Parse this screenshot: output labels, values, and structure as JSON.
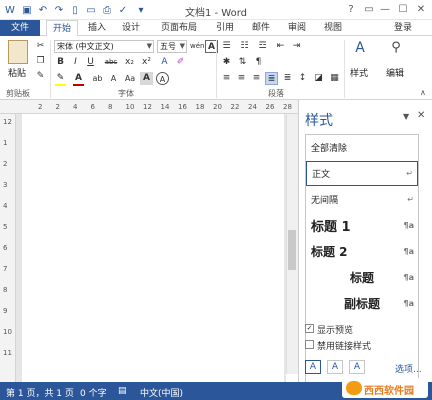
{
  "window": {
    "title": "文档1 - Word",
    "help": "?"
  },
  "tabs": [
    "文件",
    "开始",
    "插入",
    "设计",
    "页面布局",
    "引用",
    "邮件",
    "审阅",
    "视图"
  ],
  "user": "登录",
  "ribbon": {
    "paste_label": "粘贴",
    "font_name": "宋体 (中文正文)",
    "font_size": "五号",
    "groups": [
      "剪贴板",
      "字体",
      "段落",
      "样式",
      "编辑"
    ],
    "styles_label": "样式",
    "edit_label": "编辑",
    "wen_btn": "wén",
    "a_big": "A",
    "format_btns": [
      "B",
      "I",
      "U",
      "abc",
      "x₂",
      "x²"
    ],
    "font_color_btns": [
      "A",
      "ab",
      "A",
      "Aa",
      "A",
      "A"
    ]
  },
  "ruler_numbers": [
    "2",
    "2",
    "4",
    "6",
    "8",
    "10",
    "12",
    "14",
    "16",
    "18",
    "20",
    "22",
    "24",
    "26",
    "28"
  ],
  "vruler_numbers": [
    "12",
    "1",
    "2",
    "3",
    "4",
    "5",
    "6",
    "7",
    "8",
    "9",
    "10",
    "11"
  ],
  "styles_pane": {
    "title": "样式",
    "items": [
      {
        "label": "全部清除",
        "mark": ""
      },
      {
        "label": "正文",
        "mark": "↵"
      },
      {
        "label": "无间隔",
        "mark": "↵"
      },
      {
        "label": "标题 1",
        "mark": "¶a"
      },
      {
        "label": "标题 2",
        "mark": "¶a"
      },
      {
        "label": "标题",
        "mark": "¶a"
      },
      {
        "label": "副标题",
        "mark": "¶a"
      }
    ],
    "show_preview": "显示预览",
    "disable_linked": "禁用链接样式",
    "options": "选项..."
  },
  "status": {
    "page": "第 1 页，共 1 页",
    "words": "0 个字",
    "language": "中文(中国)"
  },
  "watermark": "西西软件园",
  "colors": {
    "accent": "#2b579a",
    "highlight": "#ffff00",
    "font_red": "#c00000"
  }
}
